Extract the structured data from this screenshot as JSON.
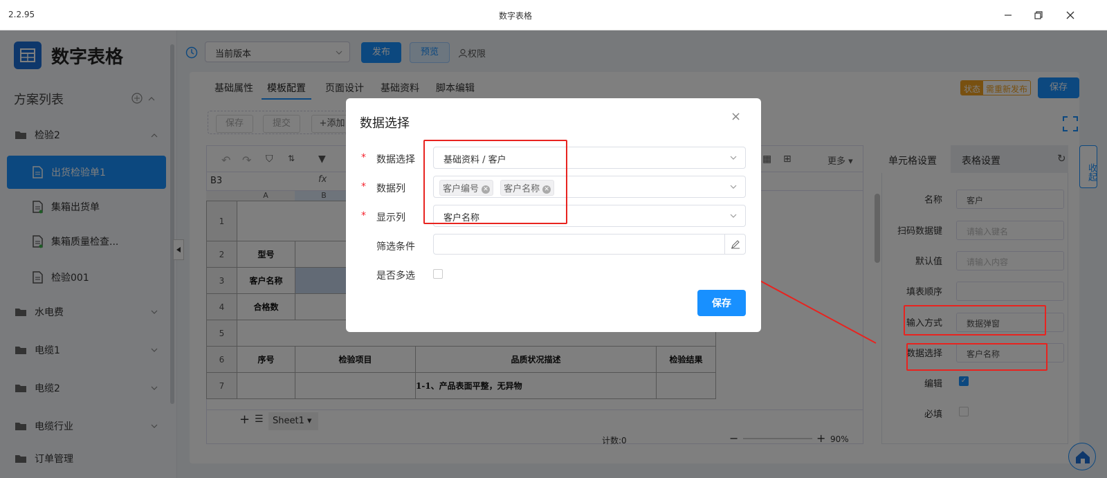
{
  "window": {
    "version": "2.2.95",
    "title": "数字表格"
  },
  "sidebar": {
    "app_name": "数字表格",
    "scheme_title": "方案列表",
    "groups": [
      {
        "label": "检验2",
        "items": [
          "出货检验单1",
          "集箱出货单",
          "集箱质量检查...",
          "检验001"
        ]
      },
      {
        "label": "水电费"
      },
      {
        "label": "电缆1"
      },
      {
        "label": "电缆2"
      },
      {
        "label": "电缆行业"
      },
      {
        "label": "订单管理"
      }
    ]
  },
  "toolbar": {
    "version_select": "当前版本",
    "publish": "发布",
    "preview": "预览",
    "permission": "权限",
    "save": "保存"
  },
  "tabs": [
    "基础属性",
    "模板配置",
    "页面设计",
    "基础资料",
    "脚本编辑"
  ],
  "active_tab": "模板配置",
  "status": {
    "key": "状态",
    "value": "需重新发布"
  },
  "actions": {
    "save": "保存",
    "submit": "提交",
    "add": "+添加"
  },
  "sheet": {
    "cell_ref": "B3",
    "fx": "fx",
    "more": "更多",
    "col_headers": [
      "A",
      "B"
    ],
    "rows": [
      {
        "num": "1",
        "a": "",
        "b": ""
      },
      {
        "num": "2",
        "a": "型号",
        "b": ""
      },
      {
        "num": "3",
        "a": "客户名称",
        "b": ""
      },
      {
        "num": "4",
        "a": "合格数",
        "b": ""
      },
      {
        "num": "5",
        "a": "",
        "b": ""
      },
      {
        "num": "6",
        "a": "序号",
        "b": "检验项目",
        "c": "品质状况描述",
        "d": "检验结果"
      },
      {
        "num": "7",
        "a": "",
        "b": "",
        "c": "1-1、产品表面平整，无异物",
        "d": ""
      }
    ],
    "sheet_tab": "Sheet1",
    "count": "计数:0",
    "zoom": "90%"
  },
  "right_panel": {
    "tab_cell": "单元格设置",
    "tab_table": "表格设置",
    "collapse": "收起",
    "fields": {
      "name_label": "名称",
      "name_value": "客户",
      "scan_label": "扫码数据键",
      "scan_placeholder": "请输入键名",
      "default_label": "默认值",
      "default_placeholder": "请输入内容",
      "order_label": "填表顺序",
      "input_label": "输入方式",
      "input_value": "数据弹窗",
      "data_label": "数据选择",
      "data_value": "客户名称",
      "edit_label": "编辑",
      "required_label": "必填"
    }
  },
  "modal": {
    "title": "数据选择",
    "close": "×",
    "data_select_label": "数据选择",
    "data_select_value": "基础资料 / 客户",
    "data_cols_label": "数据列",
    "data_cols_tags": [
      "客户编号",
      "客户名称"
    ],
    "display_label": "显示列",
    "display_value": "客户名称",
    "filter_label": "筛选条件",
    "multi_label": "是否多选",
    "save": "保存"
  }
}
